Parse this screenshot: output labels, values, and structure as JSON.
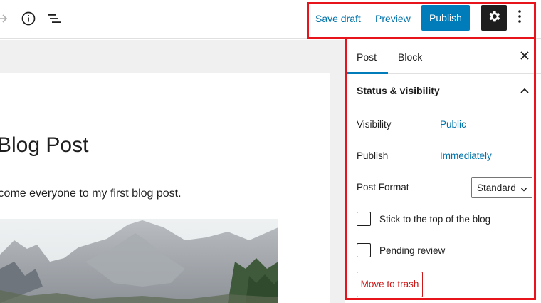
{
  "toolbar": {
    "redo_icon": "redo-arrow-icon",
    "info_icon": "info-circle-icon",
    "outline_icon": "list-view-icon",
    "save_draft_label": "Save draft",
    "preview_label": "Preview",
    "publish_label": "Publish",
    "settings_icon": "gear-icon",
    "more_icon": "vertical-ellipsis-icon"
  },
  "editor": {
    "title": "Blog Post",
    "paragraph": "lcome everyone to my first blog post.",
    "image": "mountain-landscape-photo"
  },
  "sidebar": {
    "tabs": [
      {
        "label": "Post",
        "active": true
      },
      {
        "label": "Block",
        "active": false
      }
    ],
    "close_icon": "close-icon",
    "panel": {
      "title": "Status & visibility",
      "expanded": true,
      "visibility_label": "Visibility",
      "visibility_value": "Public",
      "publish_label": "Publish",
      "publish_value": "Immediately",
      "format_label": "Post Format",
      "format_value": "Standard",
      "sticky_label": "Stick to the top of the blog",
      "sticky_checked": false,
      "pending_label": "Pending review",
      "pending_checked": false,
      "trash_label": "Move to trash"
    }
  },
  "colors": {
    "accent": "#007cba",
    "link": "#0073aa",
    "danger": "#cc1818",
    "highlight": "#e8141c"
  }
}
